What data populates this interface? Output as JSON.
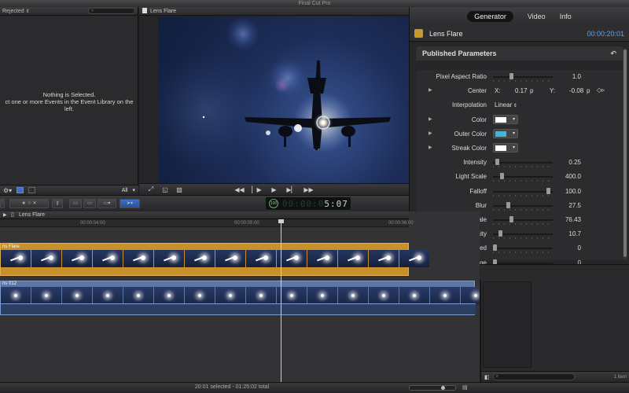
{
  "app": {
    "title": "Final Cut Pro"
  },
  "event_library": {
    "filter_label": "Rejected",
    "empty_title": "Nothing is Selected.",
    "empty_hint": "ct one or more Events in the Event Library on the left.",
    "show_label": "All"
  },
  "viewer": {
    "title": "Lens Flare"
  },
  "inspector": {
    "tabs": [
      {
        "label": "Generator",
        "selected": true
      },
      {
        "label": "Video",
        "selected": false
      },
      {
        "label": "Info",
        "selected": false
      }
    ],
    "item_name": "Lens Flare",
    "timecode": "00:00:20:01",
    "section_title": "Published Parameters",
    "center": {
      "x_label": "X:",
      "x_value": "0.17",
      "x_unit": "p",
      "y_label": "Y:",
      "y_value": "-0.08",
      "y_unit": "p"
    },
    "interpolation": {
      "value": "Linear"
    },
    "params": [
      {
        "label": "Pixel Aspect Ratio",
        "type": "slider",
        "value": "1.0",
        "level": 0.3
      },
      {
        "label": "Center",
        "type": "point",
        "expand": true
      },
      {
        "label": "Interpolation",
        "type": "popup"
      },
      {
        "label": "Color",
        "type": "color",
        "color": "#ffffff",
        "expand": true
      },
      {
        "label": "Outer Color",
        "type": "color",
        "color": "#3bb8e0",
        "expand": true
      },
      {
        "label": "Streak Color",
        "type": "color",
        "color": "#ffffff",
        "expand": true
      },
      {
        "label": "Intensity",
        "type": "slider",
        "value": "0.25",
        "level": 0.04
      },
      {
        "label": "Light Scale",
        "type": "slider",
        "value": "400.0",
        "level": 0.12
      },
      {
        "label": "Falloff",
        "type": "slider",
        "value": "100.0",
        "level": 0.96
      },
      {
        "label": "Blur",
        "type": "slider",
        "value": "27.5",
        "level": 0.24
      },
      {
        "label": "Artefact Scale",
        "type": "slider",
        "value": "76.43",
        "level": 0.3
      },
      {
        "label": "Artefacts Apacity",
        "type": "slider",
        "value": "10.7",
        "level": 0.1
      },
      {
        "label": "Flicker Speed",
        "type": "slider",
        "value": "0",
        "level": 0
      },
      {
        "label": "Flicker Range",
        "type": "slider",
        "value": "0",
        "level": 0
      }
    ]
  },
  "toolbar": {
    "timecode_lit": "5:07",
    "timecode_dim": "00:00:0",
    "timecode_badge": "100"
  },
  "timeline": {
    "project_name": "Lens Flare",
    "ruler_ticks": [
      {
        "label": "00:00:04:00"
      },
      {
        "label": "00:00:05:00"
      },
      {
        "label": "00:00:06:00"
      }
    ],
    "generator_clip_label": "ns Flare",
    "video_clip_label": "ns 012"
  },
  "browser": {
    "count_label": "1 item"
  },
  "status": {
    "text": "20:01 selected - 01:25:02 total"
  },
  "colors": {
    "accent": "#5aa4e8",
    "generator_clip": "#c8902a",
    "video_clip": "#5a77a8"
  }
}
